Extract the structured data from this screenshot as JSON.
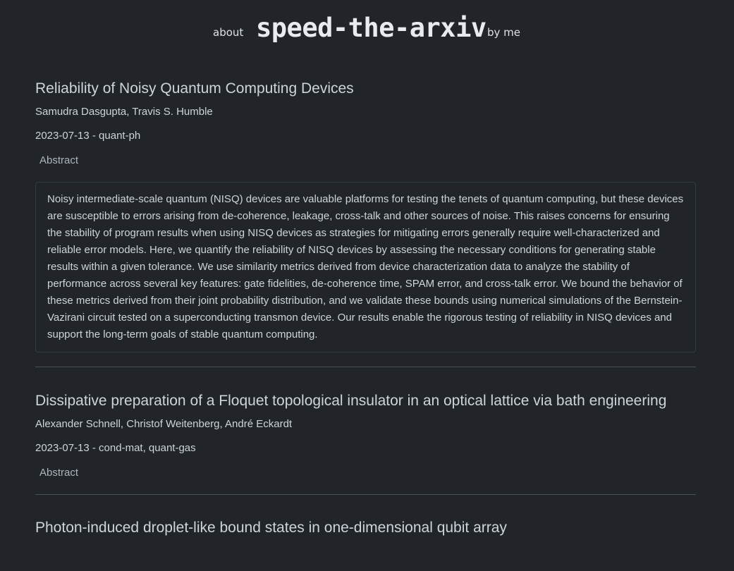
{
  "header": {
    "about_label": "about",
    "logo_text": "speed-the-arxiv",
    "byme_label": "by me"
  },
  "papers": [
    {
      "title": "Reliability of Noisy Quantum Computing Devices",
      "authors": "Samudra Dasgupta, Travis S. Humble",
      "meta": "2023-07-13 - quant-ph",
      "abstract_label": "Abstract",
      "abstract": "Noisy intermediate-scale quantum (NISQ) devices are valuable platforms for testing the tenets of quantum computing, but these devices are susceptible to errors arising from de-coherence, leakage, cross-talk and other sources of noise. This raises concerns for ensuring the stability of program results when using NISQ devices as strategies for mitigating errors generally require well-characterized and reliable error models. Here, we quantify the reliability of NISQ devices by assessing the necessary conditions for generating stable results within a given tolerance. We use similarity metrics derived from device characterization data to analyze the stability of performance across several key features: gate fidelities, de-coherence time, SPAM error, and cross-talk error. We bound the behavior of these metrics derived from their joint probability distribution, and we validate these bounds using numerical simulations of the Bernstein-Vazirani circuit tested on a superconducting transmon device. Our results enable the rigorous testing of reliability in NISQ devices and support the long-term goals of stable quantum computing."
    },
    {
      "title": "Dissipative preparation of a Floquet topological insulator in an optical lattice via bath engineering",
      "authors": "Alexander Schnell, Christof Weitenberg, André Eckardt",
      "meta": "2023-07-13 - cond-mat, quant-gas",
      "abstract_label": "Abstract"
    },
    {
      "title": "Photon-induced droplet-like bound states in one-dimensional qubit array"
    }
  ]
}
